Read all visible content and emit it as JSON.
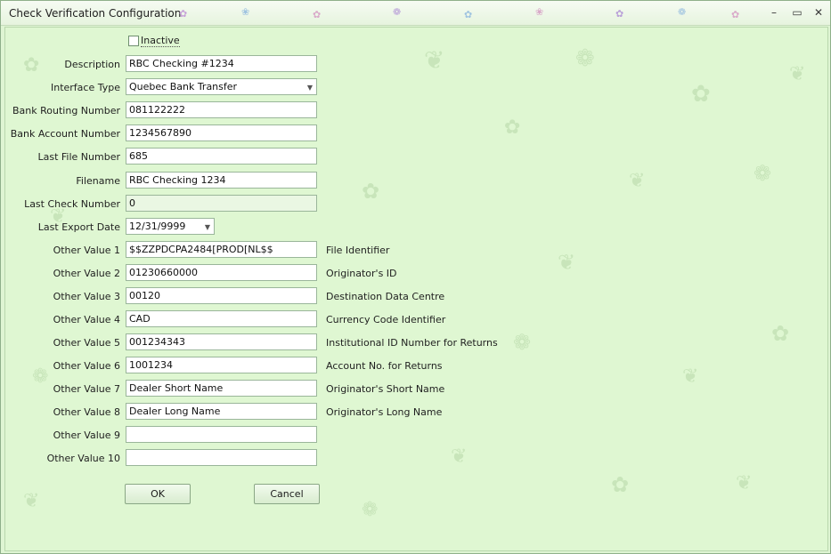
{
  "window": {
    "title": "Check Verification Configuration",
    "pin_glyph": "–",
    "restore_glyph": "▭",
    "close_glyph": "✕"
  },
  "form": {
    "inactive_label": "Inactive",
    "inactive_checked": false,
    "description": {
      "label": "Description",
      "value": "RBC Checking #1234"
    },
    "interface_type": {
      "label": "Interface Type",
      "value": "Quebec Bank Transfer"
    },
    "routing": {
      "label": "Bank Routing Number",
      "value": "081122222"
    },
    "account": {
      "label": "Bank Account Number",
      "value": "1234567890"
    },
    "last_file": {
      "label": "Last File Number",
      "value": "685"
    },
    "filename": {
      "label": "Filename",
      "value": "RBC Checking 1234"
    },
    "last_check": {
      "label": "Last Check Number",
      "value": "0"
    },
    "last_export": {
      "label": "Last Export Date",
      "value": "12/31/9999"
    },
    "other_values": [
      {
        "label": "Other Value 1",
        "value": "$$ZZPDCPA2484[PROD[NL$$",
        "desc": "File Identifier"
      },
      {
        "label": "Other Value 2",
        "value": "01230660000",
        "desc": "Originator's ID"
      },
      {
        "label": "Other Value 3",
        "value": "00120",
        "desc": "Destination Data Centre"
      },
      {
        "label": "Other Value 4",
        "value": "CAD",
        "desc": "Currency Code Identifier"
      },
      {
        "label": "Other Value 5",
        "value": "001234343",
        "desc": "Institutional ID Number for Returns"
      },
      {
        "label": "Other Value 6",
        "value": "1001234",
        "desc": "Account No. for Returns"
      },
      {
        "label": "Other Value 7",
        "value": "Dealer Short Name",
        "desc": "Originator's Short Name"
      },
      {
        "label": "Other Value 8",
        "value": "Dealer Long Name",
        "desc": "Originator's Long Name"
      },
      {
        "label": "Other Value 9",
        "value": "",
        "desc": ""
      },
      {
        "label": "Other Value 10",
        "value": "",
        "desc": ""
      }
    ]
  },
  "buttons": {
    "ok": "OK",
    "cancel": "Cancel"
  },
  "icons": {
    "dropdown": "chevron-down-icon",
    "butterfly": "butterfly-icon",
    "flower": "flower-icon"
  },
  "colors": {
    "background": "#dff7d2",
    "border": "#9ab69a"
  }
}
